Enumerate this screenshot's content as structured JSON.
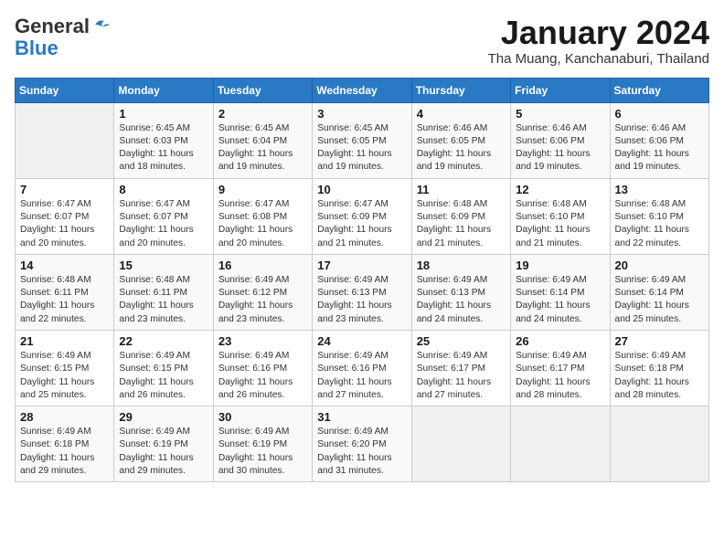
{
  "logo": {
    "general": "General",
    "blue": "Blue"
  },
  "title": "January 2024",
  "location": "Tha Muang, Kanchanaburi, Thailand",
  "days_of_week": [
    "Sunday",
    "Monday",
    "Tuesday",
    "Wednesday",
    "Thursday",
    "Friday",
    "Saturday"
  ],
  "weeks": [
    [
      {
        "num": "",
        "info": ""
      },
      {
        "num": "1",
        "info": "Sunrise: 6:45 AM\nSunset: 6:03 PM\nDaylight: 11 hours\nand 18 minutes."
      },
      {
        "num": "2",
        "info": "Sunrise: 6:45 AM\nSunset: 6:04 PM\nDaylight: 11 hours\nand 19 minutes."
      },
      {
        "num": "3",
        "info": "Sunrise: 6:45 AM\nSunset: 6:05 PM\nDaylight: 11 hours\nand 19 minutes."
      },
      {
        "num": "4",
        "info": "Sunrise: 6:46 AM\nSunset: 6:05 PM\nDaylight: 11 hours\nand 19 minutes."
      },
      {
        "num": "5",
        "info": "Sunrise: 6:46 AM\nSunset: 6:06 PM\nDaylight: 11 hours\nand 19 minutes."
      },
      {
        "num": "6",
        "info": "Sunrise: 6:46 AM\nSunset: 6:06 PM\nDaylight: 11 hours\nand 19 minutes."
      }
    ],
    [
      {
        "num": "7",
        "info": "Sunrise: 6:47 AM\nSunset: 6:07 PM\nDaylight: 11 hours\nand 20 minutes."
      },
      {
        "num": "8",
        "info": "Sunrise: 6:47 AM\nSunset: 6:07 PM\nDaylight: 11 hours\nand 20 minutes."
      },
      {
        "num": "9",
        "info": "Sunrise: 6:47 AM\nSunset: 6:08 PM\nDaylight: 11 hours\nand 20 minutes."
      },
      {
        "num": "10",
        "info": "Sunrise: 6:47 AM\nSunset: 6:09 PM\nDaylight: 11 hours\nand 21 minutes."
      },
      {
        "num": "11",
        "info": "Sunrise: 6:48 AM\nSunset: 6:09 PM\nDaylight: 11 hours\nand 21 minutes."
      },
      {
        "num": "12",
        "info": "Sunrise: 6:48 AM\nSunset: 6:10 PM\nDaylight: 11 hours\nand 21 minutes."
      },
      {
        "num": "13",
        "info": "Sunrise: 6:48 AM\nSunset: 6:10 PM\nDaylight: 11 hours\nand 22 minutes."
      }
    ],
    [
      {
        "num": "14",
        "info": "Sunrise: 6:48 AM\nSunset: 6:11 PM\nDaylight: 11 hours\nand 22 minutes."
      },
      {
        "num": "15",
        "info": "Sunrise: 6:48 AM\nSunset: 6:11 PM\nDaylight: 11 hours\nand 23 minutes."
      },
      {
        "num": "16",
        "info": "Sunrise: 6:49 AM\nSunset: 6:12 PM\nDaylight: 11 hours\nand 23 minutes."
      },
      {
        "num": "17",
        "info": "Sunrise: 6:49 AM\nSunset: 6:13 PM\nDaylight: 11 hours\nand 23 minutes."
      },
      {
        "num": "18",
        "info": "Sunrise: 6:49 AM\nSunset: 6:13 PM\nDaylight: 11 hours\nand 24 minutes."
      },
      {
        "num": "19",
        "info": "Sunrise: 6:49 AM\nSunset: 6:14 PM\nDaylight: 11 hours\nand 24 minutes."
      },
      {
        "num": "20",
        "info": "Sunrise: 6:49 AM\nSunset: 6:14 PM\nDaylight: 11 hours\nand 25 minutes."
      }
    ],
    [
      {
        "num": "21",
        "info": "Sunrise: 6:49 AM\nSunset: 6:15 PM\nDaylight: 11 hours\nand 25 minutes."
      },
      {
        "num": "22",
        "info": "Sunrise: 6:49 AM\nSunset: 6:15 PM\nDaylight: 11 hours\nand 26 minutes."
      },
      {
        "num": "23",
        "info": "Sunrise: 6:49 AM\nSunset: 6:16 PM\nDaylight: 11 hours\nand 26 minutes."
      },
      {
        "num": "24",
        "info": "Sunrise: 6:49 AM\nSunset: 6:16 PM\nDaylight: 11 hours\nand 27 minutes."
      },
      {
        "num": "25",
        "info": "Sunrise: 6:49 AM\nSunset: 6:17 PM\nDaylight: 11 hours\nand 27 minutes."
      },
      {
        "num": "26",
        "info": "Sunrise: 6:49 AM\nSunset: 6:17 PM\nDaylight: 11 hours\nand 28 minutes."
      },
      {
        "num": "27",
        "info": "Sunrise: 6:49 AM\nSunset: 6:18 PM\nDaylight: 11 hours\nand 28 minutes."
      }
    ],
    [
      {
        "num": "28",
        "info": "Sunrise: 6:49 AM\nSunset: 6:18 PM\nDaylight: 11 hours\nand 29 minutes."
      },
      {
        "num": "29",
        "info": "Sunrise: 6:49 AM\nSunset: 6:19 PM\nDaylight: 11 hours\nand 29 minutes."
      },
      {
        "num": "30",
        "info": "Sunrise: 6:49 AM\nSunset: 6:19 PM\nDaylight: 11 hours\nand 30 minutes."
      },
      {
        "num": "31",
        "info": "Sunrise: 6:49 AM\nSunset: 6:20 PM\nDaylight: 11 hours\nand 31 minutes."
      },
      {
        "num": "",
        "info": ""
      },
      {
        "num": "",
        "info": ""
      },
      {
        "num": "",
        "info": ""
      }
    ]
  ]
}
